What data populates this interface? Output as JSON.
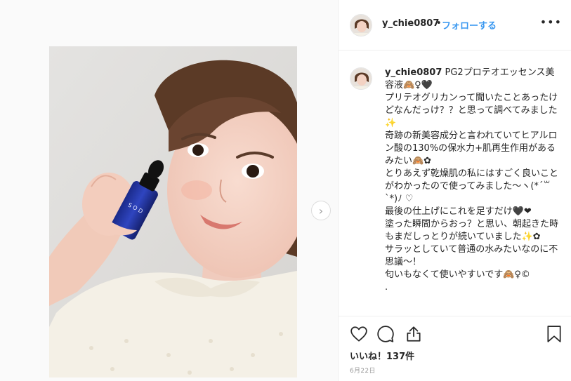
{
  "header": {
    "username": "y_chie0807",
    "separator": "•",
    "follow_label": "フォローする",
    "more_icon": "more-dots-icon"
  },
  "post": {
    "photo_alt": "smiling woman holding a blue dropper bottle",
    "bottle_label": "S O D",
    "next_icon": "chevron-right-icon"
  },
  "caption": {
    "username": "y_chie0807",
    "text": " PG2プロテオエッセンス美容液🙈♀🖤\nプリテオグリカンって聞いたことあったけどなんだっけ？？と思って調べてみました✨\n奇跡の新美容成分と言われていてヒアルロン酸の130%の保水力+肌再生作用があるみたい🙈✿\nとりあえず乾燥肌の私にはすごく良いことがわかったので使ってみました〜ヽ(*´꒳`*)ﾉ ♡\n最後の仕上げにこれを足すだけ🖤❤\n塗った瞬間からおっ？と思い、朝起きた時もまだしっとりが続いていました✨✿\nサラッとしていて普通の水みたいなのに不思議〜！\n匂いもなくて使いやすいです🙈♀©\n."
  },
  "actions": {
    "like_icon": "heart-icon",
    "comment_icon": "comment-icon",
    "share_icon": "share-icon",
    "save_icon": "bookmark-icon",
    "likes_text": "いいね！137件",
    "date_text": "6月22日"
  },
  "colors": {
    "accent": "#3897f0",
    "text": "#262626",
    "muted": "#999999",
    "border": "#efefef"
  }
}
